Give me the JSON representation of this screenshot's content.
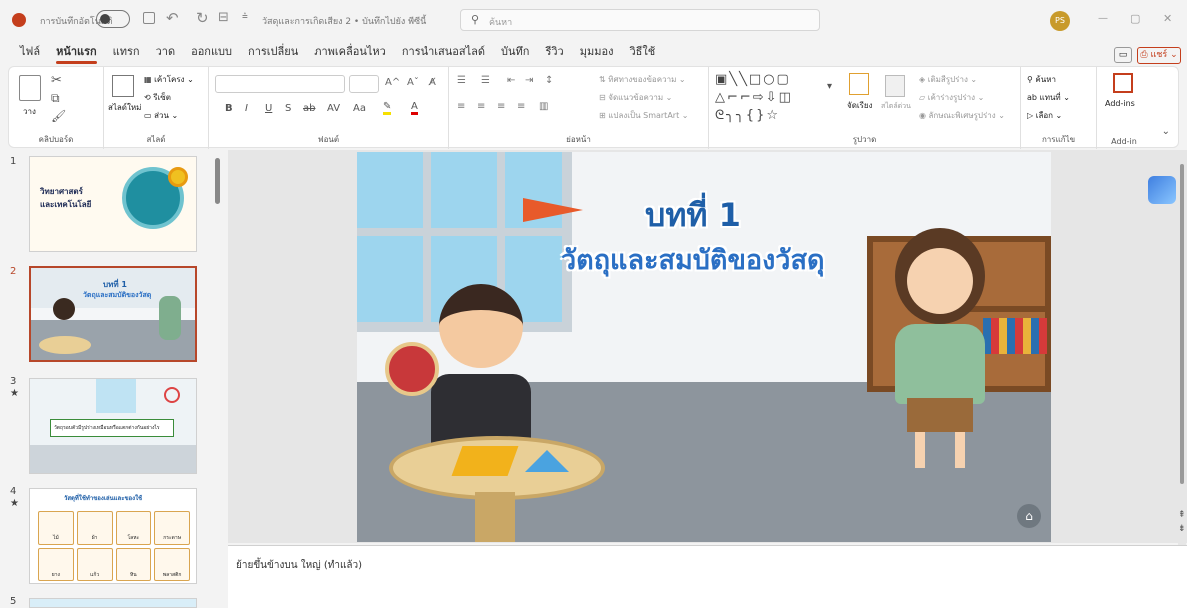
{
  "titlebar": {
    "autosave_label": "การบันทึกอัตโนมัติ",
    "doc_title": "วัสดุและการเกิดเสียง 2 • บันทึกไปยัง พีซีนี้",
    "search_placeholder": "ค้นหา",
    "user_initials": "PS",
    "minimize": "—",
    "restore": "▢",
    "close": "✕"
  },
  "ribbon_tabs": [
    "ไฟล์",
    "หน้าแรก",
    "แทรก",
    "วาด",
    "ออกแบบ",
    "การเปลี่ยน",
    "ภาพเคลื่อนไหว",
    "การนำเสนอสไลด์",
    "บันทึก",
    "รีวิว",
    "มุมมอง",
    "วิธีใช้"
  ],
  "ribbon_active_tab": "หน้าแรก",
  "ribbon_right": {
    "share_label": "แชร์"
  },
  "groups": {
    "clipboard": {
      "paste": "วาง",
      "label": "คลิปบอร์ด"
    },
    "slides": {
      "new_slide": "สไลด์ใหม่",
      "layout": "เค้าโครง",
      "reset": "รีเซ็ต",
      "section": "ส่วน",
      "label": "สไลด์"
    },
    "font": {
      "label": "ฟอนต์",
      "bold": "B",
      "italic": "I",
      "underline": "U",
      "strike": "S",
      "aa": "Aa"
    },
    "paragraph": {
      "text_dir": "ทิศทางของข้อความ",
      "align_text": "จัดแนวข้อความ",
      "smartart": "แปลงเป็น SmartArt",
      "label": "ย่อหน้า"
    },
    "drawing": {
      "arrange": "จัดเรียง",
      "quick_styles": "สไตล์ด่วน",
      "fill": "เติมสีรูปร่าง",
      "outline": "เค้าร่างรูปร่าง",
      "effects": "ลักษณะพิเศษรูปร่าง",
      "label": "รูปวาด"
    },
    "editing": {
      "find": "ค้นหา",
      "replace": "แทนที่",
      "select": "เลือก",
      "label": "การแก้ไข"
    },
    "addins": {
      "addins": "Add-ins",
      "label": "Add-in"
    }
  },
  "thumbnails": [
    {
      "num": "1",
      "star": "",
      "title": "วิทยาศาสตร์ และเทคโนโลยี"
    },
    {
      "num": "2",
      "star": "",
      "title": "บทที่ 1",
      "subtitle": "วัตถุและสมบัติของวัสดุ"
    },
    {
      "num": "3",
      "star": "★",
      "caption": "วัตถุรอบตัวมีรูปร่างเหมือนหรือแตกต่างกันอย่างไร"
    },
    {
      "num": "4",
      "star": "★",
      "title": "วัสดุที่ใช้ทำของเล่นและของใช้",
      "items": [
        "ไม้",
        "ผ้า",
        "โลหะ",
        "กระดาษ",
        "ยาง",
        "แก้ว",
        "หิน",
        "พลาสติก"
      ]
    },
    {
      "num": "5",
      "star": ""
    }
  ],
  "slide": {
    "title": "บทที่ 1",
    "subtitle": "วัตถุและสมบัติของวัสดุ"
  },
  "notes_text": "ย้ายขึ้นข้างบน ใหญ่ (ทำแล้ว)",
  "colors": {
    "accent": "#c43e1c",
    "title_blue": "#1f5fa8",
    "sub_blue": "#2a6fc4"
  }
}
